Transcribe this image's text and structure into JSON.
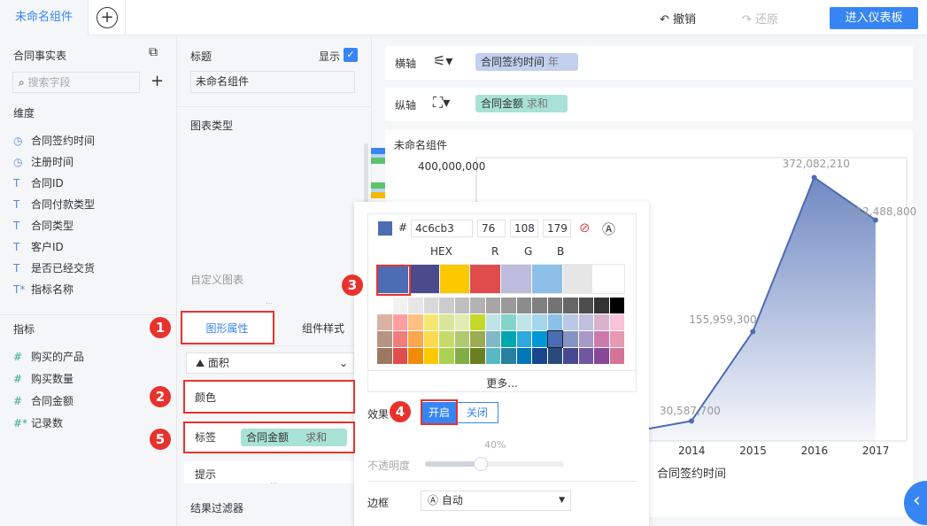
{
  "topbar": {
    "tab": "未命名组件",
    "add_icon": "plus-circle-icon",
    "undo": "撤销",
    "redo": "还原",
    "enter": "进入仪表板"
  },
  "left": {
    "table": "合同事实表",
    "switch_icon": "switch-table-icon",
    "search_placeholder": "搜索字段",
    "dim_title": "维度",
    "dimensions": [
      {
        "icon": "clock",
        "label": "合同签约时间"
      },
      {
        "icon": "clock",
        "label": "注册时间"
      },
      {
        "icon": "T",
        "label": "合同ID"
      },
      {
        "icon": "T",
        "label": "合同付款类型"
      },
      {
        "icon": "T",
        "label": "合同类型"
      },
      {
        "icon": "T",
        "label": "客户ID"
      },
      {
        "icon": "T",
        "label": "是否已经交货"
      },
      {
        "icon": "T*",
        "label": "指标名称"
      }
    ],
    "measure_title": "指标",
    "measures": [
      {
        "icon": "#",
        "label": "购买的产品"
      },
      {
        "icon": "#",
        "label": "购买数量"
      },
      {
        "icon": "#",
        "label": "合同金额"
      },
      {
        "icon": "#*",
        "label": "记录数"
      }
    ]
  },
  "mid": {
    "title_label": "标题",
    "show_label": "显示",
    "show_checked": true,
    "title_value": "未命名组件",
    "chart_type_label": "图表类型",
    "custom_chart": "自定义图表",
    "tabs": [
      "图形属性",
      "组件样式"
    ],
    "shape": "面积",
    "color_label": "颜色",
    "label_label": "标签",
    "label_field": "合同金额",
    "label_agg": "求和",
    "tip_label": "提示",
    "filter_label": "结果过滤器"
  },
  "axes": {
    "x_label": "横轴",
    "x_field": "合同签约时间",
    "x_sub": "年",
    "y_label": "纵轴",
    "y_field": "合同金额",
    "y_sub": "求和"
  },
  "chart_data": {
    "type": "area",
    "title": "未命名组件",
    "xlabel": "合同签约时间",
    "ylabel": "",
    "y_tick_top": "400,000,000",
    "ylim": [
      0,
      400000000
    ],
    "categories": [
      "2014",
      "2015",
      "2016",
      "2017"
    ],
    "values": [
      30587700,
      155959300,
      372082210,
      312488800
    ],
    "labels": [
      "30,587,700",
      "155,959,300",
      "372,082,210",
      "312,488,800"
    ],
    "color": "#4c6cb3",
    "grid": false
  },
  "picker": {
    "hex": "4c6cb3",
    "r": "76",
    "g": "108",
    "b": "179",
    "hex_label": "HEX",
    "r_label": "R",
    "g_label": "G",
    "b_label": "B",
    "more": "更多...",
    "effect_label": "效果",
    "effect_on": "开启",
    "effect_off": "关闭",
    "opacity_label": "不透明度",
    "opacity": "40%",
    "opacity_value": 40,
    "border_label": "边框",
    "border_value": "自动",
    "main_colors": [
      "#4c6cb3",
      "#4a4a8c",
      "#fcc800",
      "#e04c4c",
      "#bcbcdc",
      "#8cc0e8",
      "#e6e6e6",
      "#ffffff"
    ],
    "grid": [
      [
        "#ffffff",
        "#f2f2f2",
        "#e6e6e6",
        "#d9d9d9",
        "#cccccc",
        "#bfbfbf",
        "#b3b3b3",
        "#a6a6a6",
        "#999999",
        "#8c8c8c",
        "#808080",
        "#737373",
        "#666666",
        "#4d4d4d",
        "#333333",
        "#000000"
      ],
      [
        "#d9b3a6",
        "#ff9e9e",
        "#ffc080",
        "#f5e673",
        "#d9e699",
        "#e0ebb3",
        "#c5d92a",
        "#bfe3e6",
        "#85d4cc",
        "#c2e3e8",
        "#a3d6ed",
        "#8cc0e8",
        "#bac8e6",
        "#bfbfde",
        "#d9b3cc",
        "#fac2d6"
      ],
      [
        "#b89484",
        "#f27c7c",
        "#fca64f",
        "#fcd94f",
        "#c8d96b",
        "#b0c870",
        "#9aab50",
        "#80b8c8",
        "#00a6b0",
        "#2ea8e0",
        "#0097d6",
        "#4c6cb3",
        "#8494c4",
        "#a699c8",
        "#cc7aad",
        "#e898b0"
      ],
      [
        "#9c7860",
        "#e04c4c",
        "#f08c0a",
        "#fcc800",
        "#acd052",
        "#80ac46",
        "#6a8020",
        "#5ab8c4",
        "#2880a0",
        "#0078b8",
        "#1a4690",
        "#2a4a7a",
        "#484890",
        "#7058a0",
        "#884898",
        "#d47494"
      ]
    ]
  },
  "annotations": [
    "1",
    "2",
    "3",
    "4",
    "5"
  ]
}
